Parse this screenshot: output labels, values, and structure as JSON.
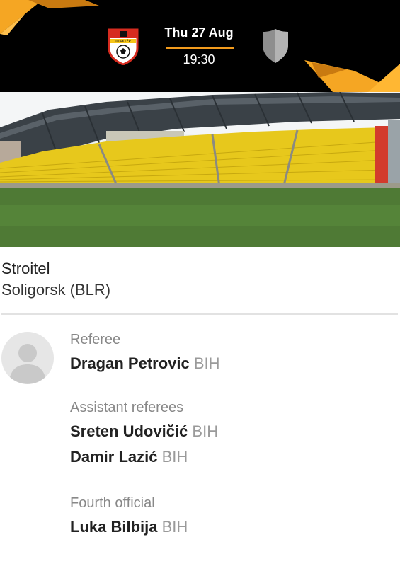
{
  "match": {
    "date": "Thu 27 Aug",
    "time": "19:30",
    "home_crest_text": "ШАХТЁР",
    "accent_color": "#f29b1d"
  },
  "venue": {
    "name": "Stroitel",
    "city": "Soligorsk (BLR)"
  },
  "officials": {
    "referee_label": "Referee",
    "referee": {
      "name": "Dragan Petrovic",
      "country": "BIH"
    },
    "assistants_label": "Assistant referees",
    "assistants": [
      {
        "name": "Sreten Udovičić",
        "country": "BIH"
      },
      {
        "name": "Damir Lazić",
        "country": "BIH"
      }
    ],
    "fourth_label": "Fourth official",
    "fourth": {
      "name": "Luka Bilbija",
      "country": "BIH"
    }
  }
}
